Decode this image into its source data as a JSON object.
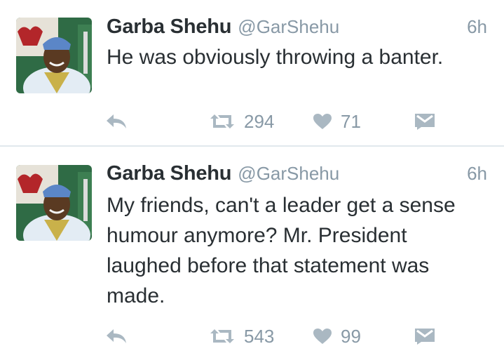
{
  "tweets": [
    {
      "name": "Garba Shehu",
      "handle": "@GarShehu",
      "time": "6h",
      "text": "He was obviously throwing a banter.",
      "retweets": "294",
      "likes": "71"
    },
    {
      "name": "Garba Shehu",
      "handle": "@GarShehu",
      "time": "6h",
      "text": "My friends, can't a leader get a sense humour anymore? Mr. President laughed before that statement was made.",
      "retweets": "543",
      "likes": "99"
    }
  ],
  "icons": {
    "reply": "reply-icon",
    "retweet": "retweet-icon",
    "like": "heart-icon",
    "dm": "envelope-icon"
  },
  "colors": {
    "text": "#292f33",
    "muted": "#8899a6",
    "icon": "#aab8c2",
    "divider": "#e1e8ed"
  }
}
